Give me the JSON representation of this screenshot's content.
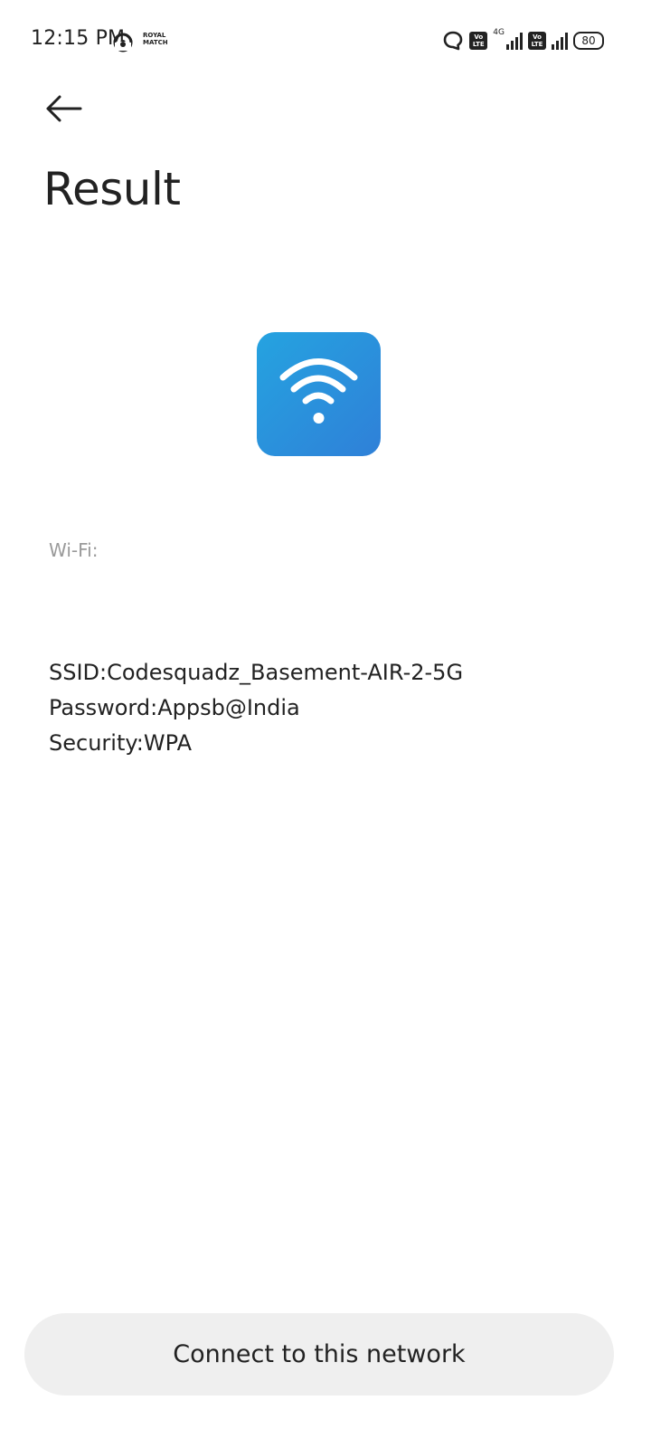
{
  "status_bar": {
    "time": "12:15 PM",
    "brand_line1": "ROYAL",
    "brand_line2": "MATCH",
    "network_label": "4G",
    "volte1": "Vo LTE",
    "volte2": "Vo LTE",
    "battery": "80",
    "icons": [
      "app-notification-icon",
      "chat-icon",
      "volte-icon",
      "signal-icon",
      "battery-icon"
    ]
  },
  "header": {
    "back_icon": "arrow-left-icon",
    "title": "Result"
  },
  "result": {
    "icon": "wifi-icon",
    "accent_color": "#2a8fdc",
    "type_label": "Wi-Fi:",
    "ssid": "SSID:Codesquadz_Basement-AIR-2-5G",
    "password": "Password:Appsb@India",
    "security": "Security:WPA"
  },
  "actions": {
    "connect_label": "Connect to this network"
  }
}
